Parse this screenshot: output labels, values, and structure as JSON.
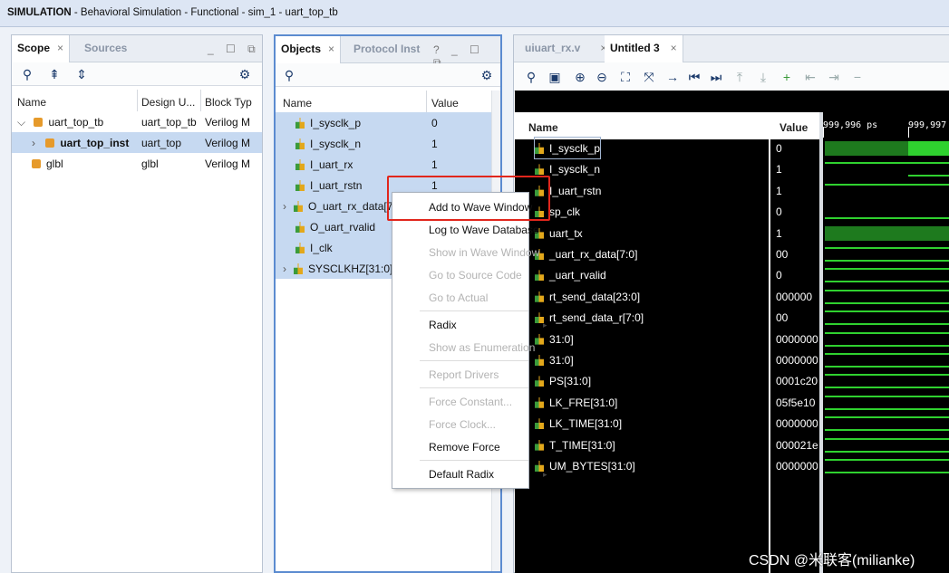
{
  "title": {
    "main": "SIMULATION",
    "rest": " - Behavioral Simulation - Functional - sim_1 - uart_top_tb"
  },
  "scope": {
    "tabs": [
      "Scope",
      "Sources"
    ],
    "columns": [
      "Name",
      "Design U...",
      "Block Typ"
    ],
    "rows": [
      {
        "name": "uart_top_tb",
        "design": "uart_top_tb",
        "type": "Verilog M"
      },
      {
        "name": "uart_top_inst",
        "design": "uart_top",
        "type": "Verilog M"
      },
      {
        "name": "glbl",
        "design": "glbl",
        "type": "Verilog M"
      }
    ]
  },
  "objects": {
    "tabs": [
      "Objects",
      "Protocol Inst"
    ],
    "columns": [
      "Name",
      "Value"
    ],
    "rows": [
      {
        "name": "I_sysclk_p",
        "value": "0"
      },
      {
        "name": "I_sysclk_n",
        "value": "1"
      },
      {
        "name": "I_uart_rx",
        "value": "1"
      },
      {
        "name": "I_uart_rstn",
        "value": "1"
      },
      {
        "name": "O_uart_rx_data[7",
        "value": ""
      },
      {
        "name": "O_uart_rvalid",
        "value": ""
      },
      {
        "name": "I_clk",
        "value": ""
      },
      {
        "name": "SYSCLKHZ[31:0]",
        "value": ""
      }
    ]
  },
  "wave": {
    "tabs": [
      "uiuart_rx.v",
      "Untitled 3"
    ],
    "columns": [
      "Name",
      "Value"
    ],
    "time1": "999,996 ps",
    "time2": "999,997",
    "rows": [
      {
        "name": "I_sysclk_p",
        "value": "0"
      },
      {
        "name": "I_sysclk_n",
        "value": "1"
      },
      {
        "name": "I_uart_rstn",
        "value": "1"
      },
      {
        "name": "sp_clk",
        "value": "0"
      },
      {
        "name": "uart_tx",
        "value": "1"
      },
      {
        "name": "_uart_rx_data[7:0]",
        "value": "00"
      },
      {
        "name": "_uart_rvalid",
        "value": "0"
      },
      {
        "name": "rt_send_data[23:0]",
        "value": "000000"
      },
      {
        "name": "rt_send_data_r[7:0]",
        "value": "00"
      },
      {
        "name": "31:0]",
        "value": "0000000"
      },
      {
        "name": "31:0]",
        "value": "0000000"
      },
      {
        "name": "PS[31:0]",
        "value": "0001c20"
      },
      {
        "name": "LK_FRE[31:0]",
        "value": "05f5e10"
      },
      {
        "name": "LK_TIME[31:0]",
        "value": "0000000"
      },
      {
        "name": "T_TIME[31:0]",
        "value": "000021e"
      },
      {
        "name": "UM_BYTES[31:0]",
        "value": "0000000"
      }
    ]
  },
  "context_menu": [
    {
      "label": "Add to Wave Window",
      "enabled": true
    },
    {
      "label": "Log to Wave Database",
      "enabled": true
    },
    {
      "label": "Show in Wave Window",
      "enabled": false
    },
    {
      "label": "Go to Source Code",
      "enabled": false
    },
    {
      "label": "Go to Actual",
      "enabled": false
    },
    {
      "label": "Radix",
      "enabled": true
    },
    {
      "label": "Show as Enumeration",
      "enabled": false
    },
    {
      "label": "Report Drivers",
      "enabled": false
    },
    {
      "label": "Force Constant...",
      "enabled": false
    },
    {
      "label": "Force Clock...",
      "enabled": false
    },
    {
      "label": "Remove Force",
      "enabled": true
    },
    {
      "label": "Default Radix",
      "enabled": true
    }
  ],
  "watermark": "CSDN @米联客(milianke)"
}
